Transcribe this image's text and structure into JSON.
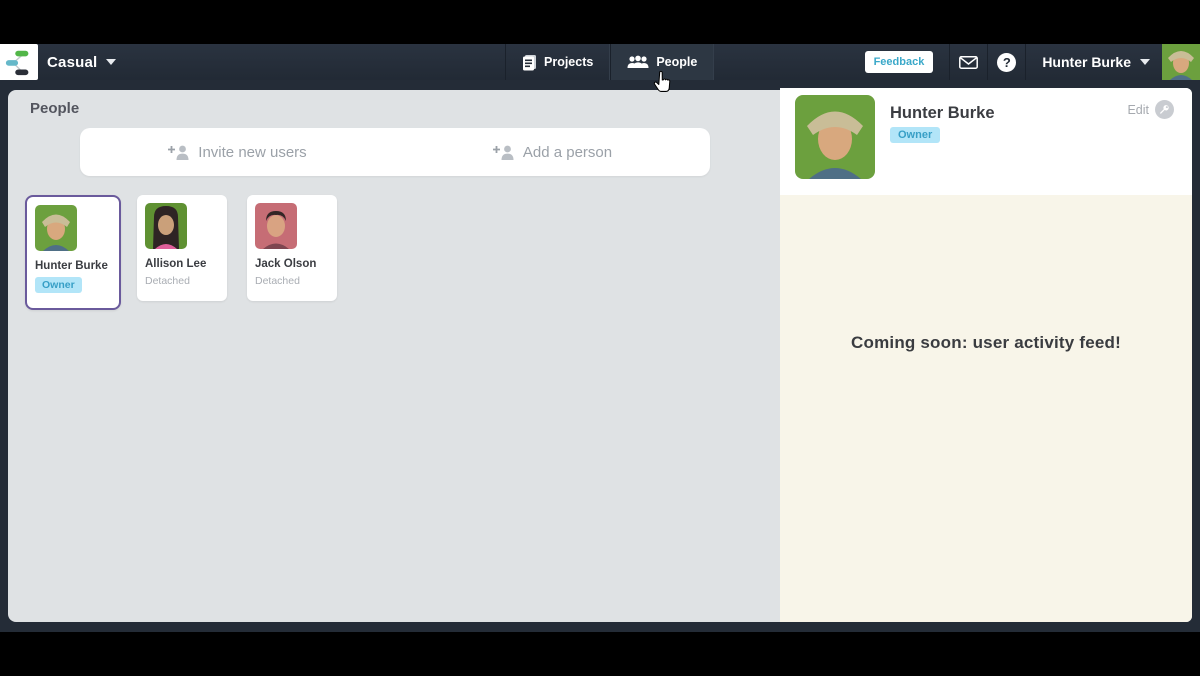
{
  "colors": {
    "window-bg": "#242c37",
    "content-bg": "#dfe2e4",
    "panel-cream": "#f8f5e9",
    "accent-teal": "#3aa8c9",
    "badge-bg": "#b2e5f8",
    "badge-text": "#379fc6",
    "selected-border": "#6a5a9c",
    "muted-text": "#9ba1a8",
    "dark-text": "#3b3d42"
  },
  "header": {
    "app_name": "Casual",
    "tabs": [
      {
        "label": "Projects"
      },
      {
        "label": "People"
      }
    ],
    "feedback_label": "Feedback",
    "user_name": "Hunter Burke"
  },
  "people_page": {
    "title": "People",
    "invite_bar": {
      "invite_label": "Invite new users",
      "add_label": "Add a person"
    },
    "cards": [
      {
        "name": "Hunter Burke",
        "status": "Owner",
        "selected": true
      },
      {
        "name": "Allison Lee",
        "status": "Detached",
        "selected": false
      },
      {
        "name": "Jack Olson",
        "status": "Detached",
        "selected": false
      }
    ]
  },
  "profile_panel": {
    "name": "Hunter Burke",
    "badge": "Owner",
    "edit_label": "Edit",
    "activity_message": "Coming soon: user activity feed!"
  }
}
